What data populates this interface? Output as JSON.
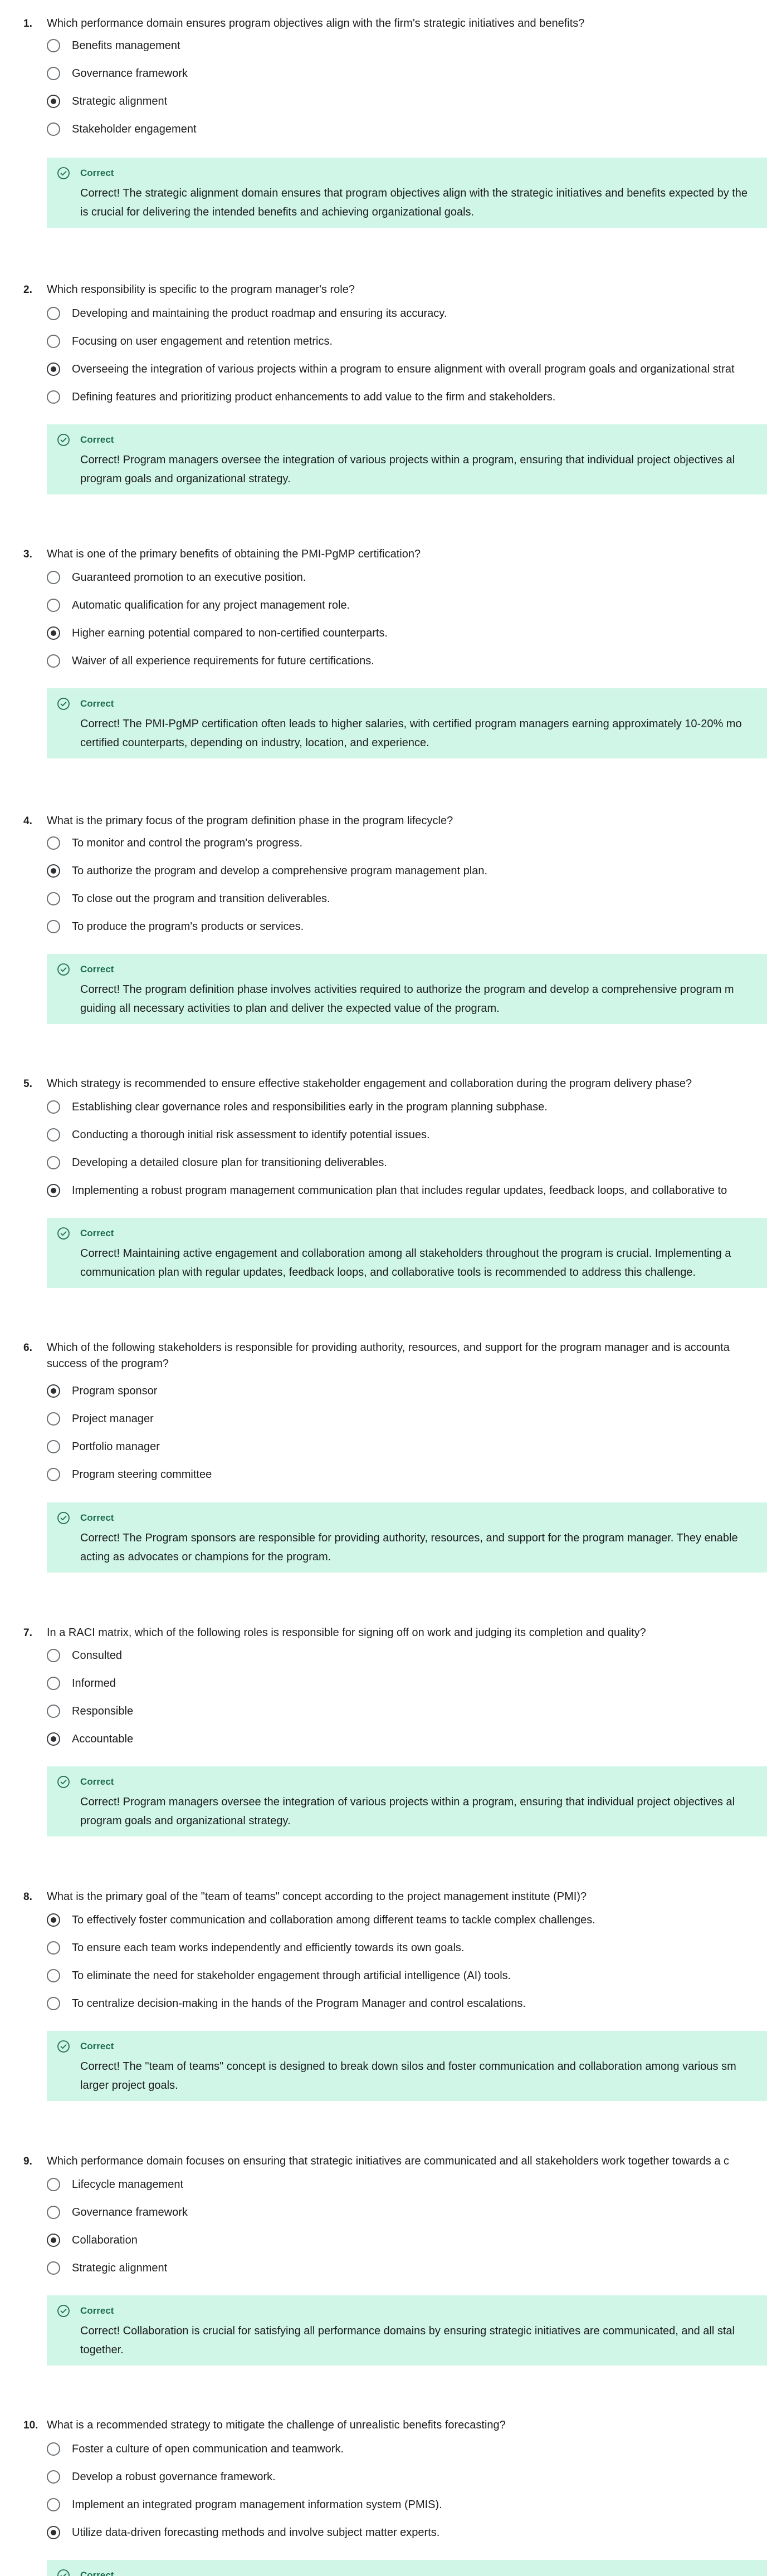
{
  "correct_label": "Correct",
  "questions": [
    {
      "number": "1.",
      "text": "Which performance domain ensures program objectives align with the firm's strategic initiatives and benefits?",
      "options": [
        "Benefits management",
        "Governance framework",
        "Strategic alignment",
        "Stakeholder engagement"
      ],
      "selected": 2,
      "feedback": "Correct! The strategic alignment domain ensures that program objectives align with the strategic initiatives and benefits expected by the\nis crucial for delivering the intended benefits and achieving organizational goals."
    },
    {
      "number": "2.",
      "text": "Which responsibility is specific to the program manager's role?",
      "options": [
        "Developing and maintaining the product roadmap and ensuring its accuracy.",
        "Focusing on user engagement and retention metrics.",
        "Overseeing the integration of various projects within a program to ensure alignment with overall program goals and organizational strat",
        "Defining features and prioritizing product enhancements to add value to the firm and stakeholders."
      ],
      "selected": 2,
      "feedback": "Correct! Program managers oversee the integration of various projects within a program, ensuring that individual project objectives al\nprogram goals and organizational strategy."
    },
    {
      "number": "3.",
      "text": "What is one of the primary benefits of obtaining the PMI-PgMP certification?",
      "options": [
        "Guaranteed promotion to an executive position.",
        "Automatic qualification for any project management role.",
        "Higher earning potential compared to non-certified counterparts.",
        "Waiver of all experience requirements for future certifications."
      ],
      "selected": 2,
      "feedback": "Correct! The PMI-PgMP certification often leads to higher salaries, with certified program managers earning approximately 10-20% mo\ncertified counterparts, depending on industry, location, and experience."
    },
    {
      "number": "4.",
      "text": "What is the primary focus of the program definition phase in the program lifecycle?",
      "options": [
        "To monitor and control the program's progress.",
        "To authorize the program and develop a comprehensive program management plan.",
        "To close out the program and transition deliverables.",
        "To produce the program's products or services."
      ],
      "selected": 1,
      "feedback": "Correct! The program definition phase involves activities required to authorize the program and develop a comprehensive program m\nguiding all necessary activities to plan and deliver the expected value of the program."
    },
    {
      "number": "5.",
      "text": "Which strategy is recommended to ensure effective stakeholder engagement and collaboration during the program delivery phase?",
      "options": [
        "Establishing clear governance roles and responsibilities early in the program planning subphase.",
        "Conducting a thorough initial risk assessment to identify potential issues.",
        "Developing a detailed closure plan for transitioning deliverables.",
        "Implementing a robust program management communication plan that includes regular updates, feedback loops, and collaborative to"
      ],
      "selected": 3,
      "feedback": "Correct! Maintaining active engagement and collaboration among all stakeholders throughout the program is crucial. Implementing a\ncommunication plan with regular updates, feedback loops, and collaborative tools is recommended to address this challenge."
    },
    {
      "number": "6.",
      "text": "Which of the following stakeholders is responsible for providing authority, resources, and support for the program manager and is accounta\nsuccess of the program?",
      "options": [
        "Program sponsor",
        "Project manager",
        "Portfolio manager",
        "Program steering committee"
      ],
      "selected": 0,
      "feedback": "Correct! The Program sponsors are responsible for providing authority, resources, and support for the program manager. They enable\nacting as advocates or champions for the program."
    },
    {
      "number": "7.",
      "text": "In a RACI matrix, which of the following roles is responsible for signing off on work and judging its completion and quality?",
      "options": [
        "Consulted",
        "Informed",
        "Responsible",
        "Accountable"
      ],
      "selected": 3,
      "feedback": "Correct! Program managers oversee the integration of various projects within a program, ensuring that individual project objectives al\nprogram goals and organizational strategy."
    },
    {
      "number": "8.",
      "text": "What is the primary goal of the \"team of teams\" concept according to the project management institute (PMI)?",
      "options": [
        "To effectively foster communication and collaboration among different teams to tackle complex challenges.",
        "To ensure each team works independently and efficiently towards its own goals.",
        "To eliminate the need for stakeholder engagement through artificial intelligence (AI) tools.",
        "To centralize decision-making in the hands of the Program Manager and control escalations."
      ],
      "selected": 0,
      "feedback": "Correct! The \"team of teams\" concept is designed to break down silos and foster communication and collaboration among various sm\nlarger project goals."
    },
    {
      "number": "9.",
      "text": "Which performance domain focuses on ensuring that strategic initiatives are communicated and all stakeholders work together towards a c",
      "options": [
        "Lifecycle management",
        "Governance framework",
        "Collaboration",
        "Strategic alignment"
      ],
      "selected": 2,
      "feedback": "Correct! Collaboration is crucial for satisfying all performance domains by ensuring strategic initiatives are communicated, and all stal\ntogether."
    },
    {
      "number": "10.",
      "text": "What is a recommended strategy to mitigate the challenge of unrealistic benefits forecasting?",
      "options": [
        "Foster a culture of open communication and teamwork.",
        "Develop a robust governance framework.",
        "Implement an integrated program management information system (PMIS).",
        "Utilize data-driven forecasting methods and involve subject matter experts."
      ],
      "selected": 3,
      "feedback": ""
    }
  ]
}
